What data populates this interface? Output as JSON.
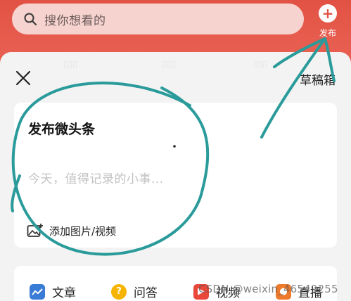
{
  "search": {
    "placeholder": "搜你想看的"
  },
  "header": {
    "publish_label": "发布"
  },
  "sheet": {
    "drafts_label": "草稿箱",
    "title": "发布微头条",
    "placeholder": "今天，值得记录的小事...",
    "media_label": "添加图片/视频"
  },
  "bottom_actions": [
    {
      "label": "文章",
      "icon": "article-icon",
      "color": "#3a7bd5"
    },
    {
      "label": "问答",
      "icon": "question-icon",
      "color": "#f5b400"
    },
    {
      "label": "视频",
      "icon": "video-icon",
      "color": "#e8473a"
    },
    {
      "label": "直播",
      "icon": "live-icon",
      "color": "#f07a2b"
    }
  ],
  "watermark": "CSDN @weixin_46549255",
  "annotation": {
    "color": "#2a9b9a"
  }
}
